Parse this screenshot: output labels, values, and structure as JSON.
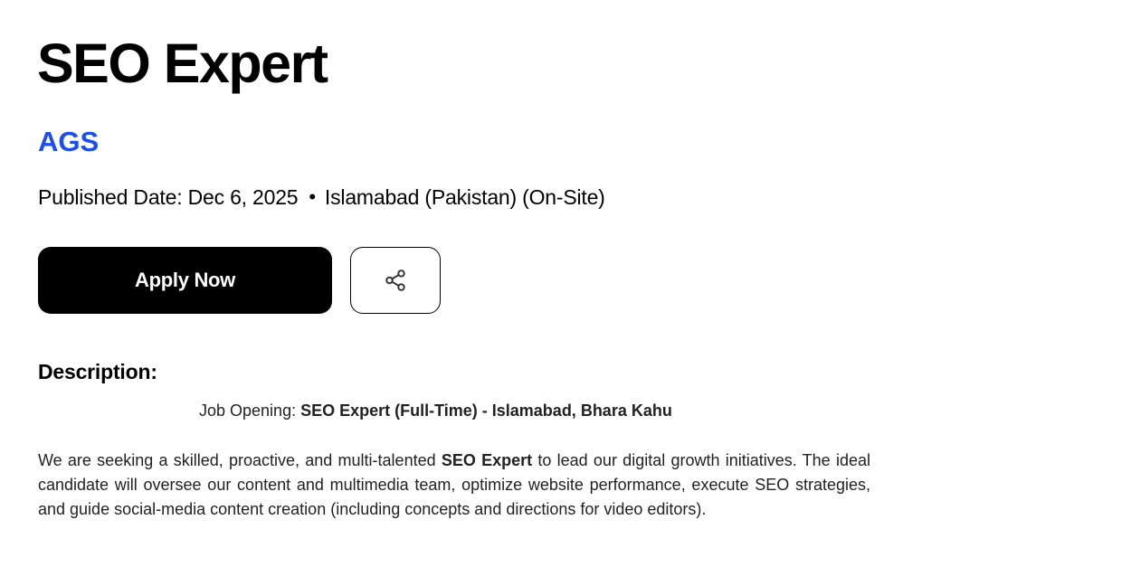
{
  "job": {
    "title": "SEO Expert",
    "company": "AGS",
    "published_label": "Published Date: Dec 6, 2025",
    "separator": "•",
    "location": "Islamabad (Pakistan) (On-Site)"
  },
  "actions": {
    "apply_label": "Apply Now",
    "share_icon": "share-icon"
  },
  "description": {
    "heading": "Description:",
    "opening_prefix": "Job Opening: ",
    "opening_bold": "SEO Expert (Full-Time) - Islamabad, Bhara Kahu",
    "para_1": "We are seeking a skilled, proactive, and multi-talented ",
    "para_bold": "SEO Expert",
    "para_2": " to lead our digital growth initiatives. The ideal candidate will oversee our content and multimedia team, optimize website performance, execute SEO strategies, and guide social-media content creation (including concepts and directions for video editors)."
  },
  "colors": {
    "company_link": "#1a4ef2",
    "apply_bg": "#000000",
    "apply_text": "#ffffff"
  }
}
